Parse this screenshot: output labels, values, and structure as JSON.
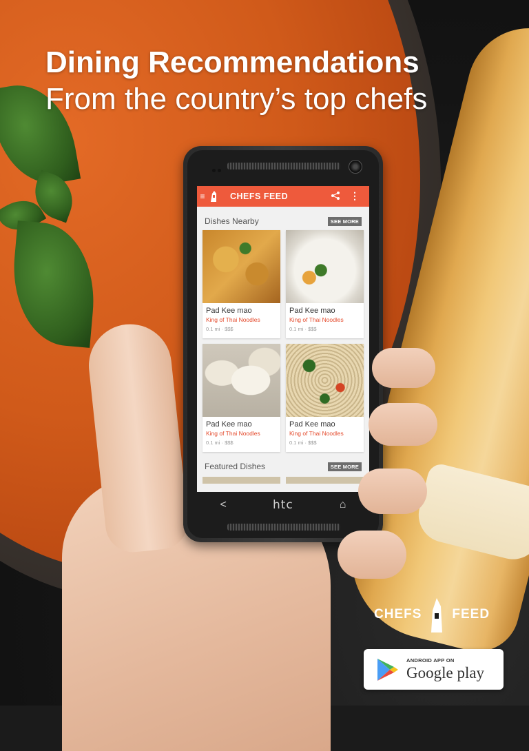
{
  "headline": {
    "line1": "Dining Recommendations",
    "line2": "From the country’s top chefs"
  },
  "app": {
    "title": "CHEFS FEED",
    "menu_icon": "hamburger-icon",
    "share_icon": "share-icon",
    "overflow_icon": "overflow-menu-icon",
    "accent_color": "#ee5a3c",
    "sections": [
      {
        "title": "Dishes Nearby",
        "see_more": "SEE MORE",
        "cards": [
          {
            "dish": "Pad Kee mao",
            "restaurant": "King of Thai Noodles",
            "meta": "0.1 mi · $$$"
          },
          {
            "dish": "Pad Kee mao",
            "restaurant": "King of Thai Noodles",
            "meta": "0.1 mi · $$$"
          },
          {
            "dish": "Pad Kee mao",
            "restaurant": "King of Thai Noodles",
            "meta": "0.1 mi · $$$"
          },
          {
            "dish": "Pad Kee mao",
            "restaurant": "King of Thai Noodles",
            "meta": "0.1 mi · $$$"
          }
        ]
      },
      {
        "title": "Featured Dishes",
        "see_more": "SEE MORE"
      }
    ]
  },
  "phone": {
    "brand": "htc",
    "nav": {
      "back": "<",
      "home": "⌂"
    }
  },
  "brand_logo": {
    "left": "CHEFS",
    "right": "FEED"
  },
  "store_badge": {
    "small": "ANDROID APP ON",
    "big": "Google play"
  }
}
